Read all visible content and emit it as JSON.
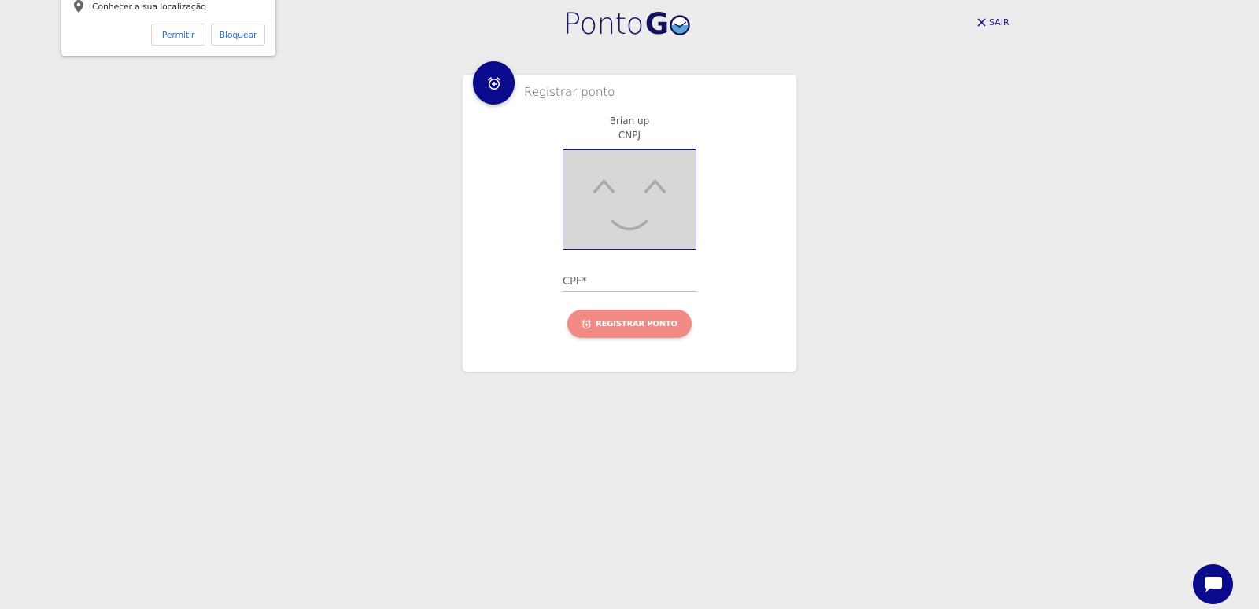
{
  "permission_popup": {
    "text": "Conhecer a sua localização",
    "allow_label": "Permitir",
    "block_label": "Bloquear",
    "icon": "location-pin-icon"
  },
  "header": {
    "logo_text": "Ponto",
    "logo_g": "G",
    "logo_o_icon": "clock-globe-icon",
    "logout_label": "SAIR",
    "logout_icon": "close-icon"
  },
  "card": {
    "title": "Registrar ponto",
    "badge_icon": "alarm-add-icon",
    "company_name": "Brian up",
    "company_doc_label": "CNPJ",
    "photo_placeholder_icon": "smiley-face-icon",
    "cpf_placeholder": "CPF*",
    "cpf_value": "",
    "register_label": "REGISTRAR PONTO",
    "register_icon": "alarm-add-icon"
  },
  "chat": {
    "icon": "chat-bubble-icon"
  },
  "colors": {
    "background": "#ececec",
    "brand_navy": "#0a0a8c",
    "register_button": "#f28b84",
    "link_blue": "#2a6fd6"
  }
}
